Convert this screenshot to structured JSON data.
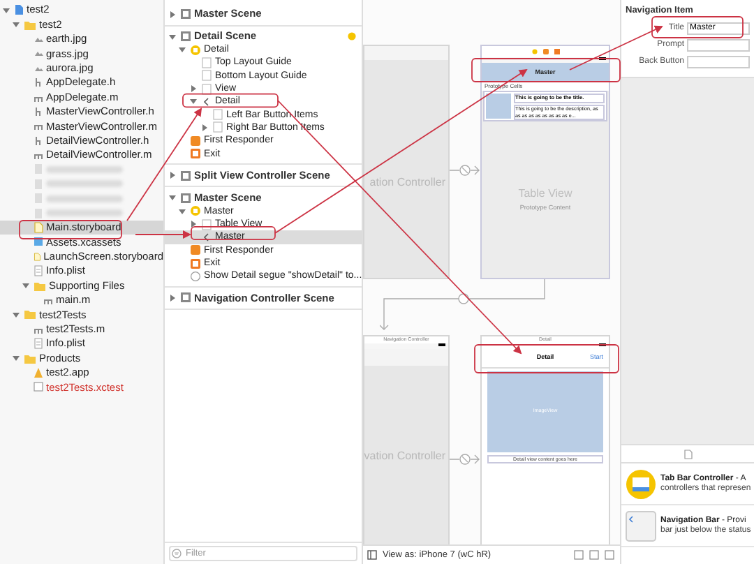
{
  "navigator": {
    "tree": [
      {
        "name": "test2",
        "kind": "project",
        "expanded": true,
        "selected": false,
        "children": [
          {
            "name": "test2",
            "kind": "folder",
            "expanded": true,
            "selected": false,
            "children": [
              {
                "name": "earth.jpg",
                "kind": "image",
                "selected": false
              },
              {
                "name": "grass.jpg",
                "kind": "image",
                "selected": false
              },
              {
                "name": "aurora.jpg",
                "kind": "image",
                "selected": false
              },
              {
                "name": "AppDelegate.h",
                "kind": "header",
                "selected": false
              },
              {
                "name": "AppDelegate.m",
                "kind": "source",
                "selected": false
              },
              {
                "name": "MasterViewController.h",
                "kind": "header",
                "selected": false
              },
              {
                "name": "MasterViewController.m",
                "kind": "source",
                "selected": false
              },
              {
                "name": "DetailViewController.h",
                "kind": "header",
                "selected": false
              },
              {
                "name": "DetailViewController.m",
                "kind": "source",
                "selected": false
              },
              {
                "kind": "redacted",
                "selected": false
              },
              {
                "kind": "redacted",
                "selected": false
              },
              {
                "kind": "redacted",
                "selected": false
              },
              {
                "kind": "redacted",
                "selected": false
              },
              {
                "name": "Main.storyboard",
                "kind": "storyboard",
                "selected": true
              },
              {
                "name": "Assets.xcassets",
                "kind": "assets",
                "selected": false
              },
              {
                "name": "LaunchScreen.storyboard",
                "kind": "storyboard",
                "selected": false
              },
              {
                "name": "Info.plist",
                "kind": "plist",
                "selected": false
              },
              {
                "name": "Supporting Files",
                "kind": "folder",
                "expanded": true,
                "selected": false,
                "children": [
                  {
                    "name": "main.m",
                    "kind": "source",
                    "selected": false
                  }
                ]
              }
            ]
          },
          {
            "name": "test2Tests",
            "kind": "folder",
            "expanded": true,
            "selected": false,
            "children": [
              {
                "name": "test2Tests.m",
                "kind": "source",
                "selected": false
              },
              {
                "name": "Info.plist",
                "kind": "plist",
                "selected": false
              }
            ]
          },
          {
            "name": "Products",
            "kind": "folder",
            "expanded": true,
            "selected": false,
            "children": [
              {
                "name": "test2.app",
                "kind": "app",
                "selected": false
              },
              {
                "name": "test2Tests.xctest",
                "kind": "xctest",
                "missing": true,
                "selected": false
              }
            ]
          }
        ]
      }
    ]
  },
  "outline": {
    "sections": [
      {
        "title": "Master Scene",
        "expanded": false
      },
      {
        "title": "Detail Scene",
        "expanded": true,
        "warning": true,
        "items": [
          {
            "name": "Detail",
            "kind": "controller",
            "expanded": true,
            "selected": false,
            "children": [
              {
                "name": "Top Layout Guide",
                "kind": "guide",
                "selected": false
              },
              {
                "name": "Bottom Layout Guide",
                "kind": "guide",
                "selected": false
              },
              {
                "name": "View",
                "kind": "view",
                "expanded": false,
                "selected": false
              },
              {
                "name": "Detail",
                "kind": "nav_item",
                "expanded": true,
                "selected": false,
                "children": [
                  {
                    "name": "Left Bar Button Items",
                    "kind": "bar_items",
                    "selected": false
                  },
                  {
                    "name": "Right Bar Button Items",
                    "kind": "bar_items",
                    "expanded": false,
                    "selected": false
                  }
                ]
              }
            ]
          },
          {
            "name": "First Responder",
            "kind": "responder",
            "selected": false
          },
          {
            "name": "Exit",
            "kind": "exit",
            "selected": false
          }
        ]
      },
      {
        "title": "Split View Controller Scene",
        "expanded": false
      },
      {
        "title": "Master Scene",
        "expanded": true,
        "items": [
          {
            "name": "Master",
            "kind": "controller",
            "expanded": true,
            "selected": false,
            "children": [
              {
                "name": "Table View",
                "kind": "view",
                "expanded": false,
                "selected": false
              },
              {
                "name": "Master",
                "kind": "nav_item",
                "selected": true
              }
            ]
          },
          {
            "name": "First Responder",
            "kind": "responder",
            "selected": false
          },
          {
            "name": "Exit",
            "kind": "exit",
            "selected": false
          },
          {
            "name": "Show Detail segue \"showDetail\" to...",
            "kind": "segue",
            "selected": false
          }
        ]
      },
      {
        "title": "Navigation Controller Scene",
        "expanded": false
      }
    ],
    "filter_placeholder": "Filter"
  },
  "canvas": {
    "nav_controller_top": {
      "label": "ation Controller"
    },
    "master_scene": {
      "nav_title": "Master",
      "section_header": "Prototype Cells",
      "cell_title": "This is going to be the title.",
      "cell_description": "This is going to be the description, as as as as as as as as as e...",
      "placeholder_title": "Table View",
      "placeholder_subtitle": "Prototype Content"
    },
    "nav_controller_bottom": {
      "caption": "Navigation Controller",
      "label": "vation Controller"
    },
    "detail_scene": {
      "caption": "Detail",
      "nav_title": "Detail",
      "bar_button": "Start",
      "image_label": "ImageView",
      "content_label": "Detail view content goes here"
    },
    "view_as": "View as: iPhone 7 (wC hR)"
  },
  "inspector": {
    "title": "Navigation Item",
    "fields": [
      {
        "label": "Title",
        "value": "Master"
      },
      {
        "label": "Prompt"
      },
      {
        "label": "Back Button"
      }
    ],
    "library": [
      {
        "kind": "tab_bar",
        "title": "Tab Bar Controller",
        "summary": " - A",
        "detail": "controllers that represen"
      },
      {
        "kind": "nav_bar",
        "title": "Navigation Bar",
        "summary": " - Provi",
        "detail": "bar just below the status"
      }
    ]
  }
}
